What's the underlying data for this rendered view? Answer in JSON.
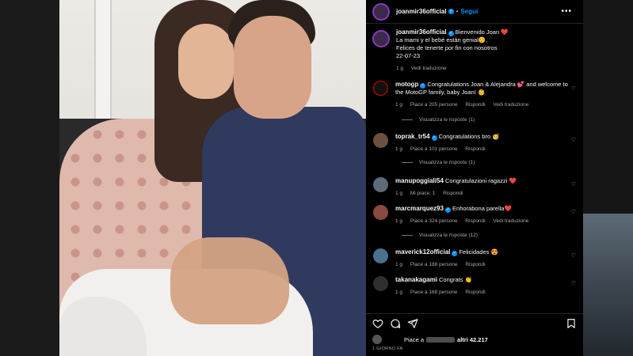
{
  "header": {
    "username": "joanmir36official",
    "follow_label": "Segui",
    "more_label": "•••"
  },
  "caption": {
    "username": "joanmir36official",
    "lines": [
      "Bienvenido Joan ❤️",
      "La mami y el bebé están genial😊,",
      "Felices de tenerte por fin con nosotros",
      "22-07-23"
    ],
    "age": "1 g",
    "translate": "Vedi traduzione"
  },
  "comments": [
    {
      "username": "motogp",
      "text": "Congratulations Joan & Alejandra 💕 and welcome to the MotoGP family, baby Joan! 👶",
      "age": "1 g",
      "likes": "Piace a 205 persone",
      "reply": "Rispondi",
      "translate": "Vedi traduzione",
      "replies": "Visualizza le risposte (1)"
    },
    {
      "username": "toprak_tr54",
      "text": "Congratulations bro 🥳",
      "age": "1 g",
      "likes": "Piace a 101 persone",
      "reply": "Rispondi",
      "replies": "Visualizza le risposte (1)"
    },
    {
      "username": "manupoggiali54",
      "text": "Congratulazioni ragazzi ❤️",
      "age": "1 g",
      "likes": "Mi piace: 1",
      "reply": "Rispondi"
    },
    {
      "username": "marcmarquez93",
      "text": "Enhorabona parella❤️",
      "age": "1 g",
      "likes": "Piace a 324 persone",
      "reply": "Rispondi",
      "translate": "Vedi traduzione",
      "replies": "Visualizza le risposte (12)"
    },
    {
      "username": "maverick12official",
      "text": "Felicidades 😍",
      "age": "1 g",
      "likes": "Piace a 188 persone",
      "reply": "Rispondi"
    },
    {
      "username": "takanakagami",
      "text": "Congrats 👏",
      "age": "1 g",
      "likes": "Piace a 168 persone",
      "reply": "Rispondi"
    }
  ],
  "footer": {
    "likes_prefix": "Piace a",
    "likes_suffix": "altri 42.217",
    "when": "1 GIORNO FA"
  },
  "icons": {
    "like": "heart-outline-icon",
    "comment": "comment-icon",
    "share": "send-icon",
    "save": "bookmark-icon"
  },
  "colors": {
    "accent": "#0095f6",
    "panel_bg": "#000000",
    "muted": "#a8a8a8"
  }
}
